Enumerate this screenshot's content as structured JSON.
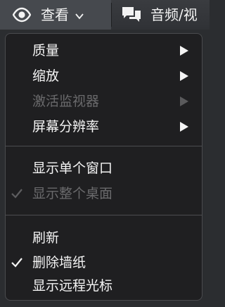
{
  "toolbar": {
    "view_label": "查看",
    "view_icon": "eye-icon",
    "audio_label": "音频/视",
    "audio_icon": "chat-bubbles-icon"
  },
  "menu": {
    "groups": [
      {
        "items": [
          {
            "label": "质量",
            "submenu": true,
            "enabled": true,
            "checked": false
          },
          {
            "label": "缩放",
            "submenu": true,
            "enabled": true,
            "checked": false
          },
          {
            "label": "激活监视器",
            "submenu": true,
            "enabled": false,
            "checked": false
          },
          {
            "label": "屏幕分辨率",
            "submenu": true,
            "enabled": true,
            "checked": false
          }
        ]
      },
      {
        "items": [
          {
            "label": "显示单个窗口",
            "submenu": false,
            "enabled": true,
            "checked": false
          },
          {
            "label": "显示整个桌面",
            "submenu": false,
            "enabled": false,
            "checked": true
          }
        ]
      },
      {
        "items": [
          {
            "label": "刷新",
            "submenu": false,
            "enabled": true,
            "checked": false
          },
          {
            "label": "删除墙纸",
            "submenu": false,
            "enabled": true,
            "checked": true
          },
          {
            "label": "显示远程光标",
            "submenu": false,
            "enabled": true,
            "checked": false
          }
        ]
      }
    ]
  },
  "colors": {
    "menu_background": "#1f1f21",
    "text": "#f4f4f4",
    "disabled_text": "#6a6a6c",
    "toolbar_active": "#46494e"
  }
}
